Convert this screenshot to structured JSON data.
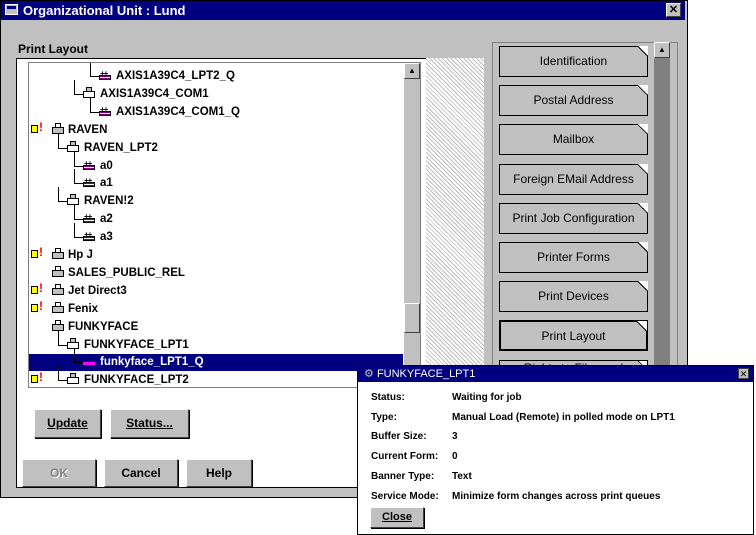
{
  "window": {
    "title": "Organizational Unit : Lund",
    "close_glyph": "✕"
  },
  "print_layout": {
    "label": "Print Layout"
  },
  "tree": [
    {
      "indent": 3,
      "icon": "queue-icon",
      "label": "AXIS1A39C4_LPT2_Q",
      "status": ""
    },
    {
      "indent": 2,
      "icon": "printer-icon",
      "label": "AXIS1A39C4_COM1",
      "status": ""
    },
    {
      "indent": 3,
      "icon": "queue-icon",
      "label": "AXIS1A39C4_COM1_Q",
      "status": ""
    },
    {
      "indent": 0,
      "icon": "print-server-icon",
      "label": "RAVEN",
      "status": "alert"
    },
    {
      "indent": 1,
      "icon": "printer-icon",
      "label": "RAVEN_LPT2",
      "status": ""
    },
    {
      "indent": 2,
      "icon": "queue-icon",
      "label": "a0",
      "status": ""
    },
    {
      "indent": 2,
      "icon": "queue-icon",
      "label": "a1",
      "status": ""
    },
    {
      "indent": 1,
      "icon": "printer-icon",
      "label": "RAVEN!2",
      "status": ""
    },
    {
      "indent": 2,
      "icon": "queue-icon",
      "label": "a2",
      "status": ""
    },
    {
      "indent": 2,
      "icon": "queue-icon",
      "label": "a3",
      "status": ""
    },
    {
      "indent": 0,
      "icon": "print-server-icon",
      "label": "Hp J",
      "status": "alert"
    },
    {
      "indent": 0,
      "icon": "print-server-icon",
      "label": "SALES_PUBLIC_REL",
      "status": ""
    },
    {
      "indent": 0,
      "icon": "print-server-icon",
      "label": "Jet Direct3",
      "status": "alert"
    },
    {
      "indent": 0,
      "icon": "print-server-icon",
      "label": "Fenix",
      "status": "alert"
    },
    {
      "indent": 0,
      "icon": "print-server-icon",
      "label": "FUNKYFACE",
      "status": ""
    },
    {
      "indent": 1,
      "icon": "printer-icon",
      "label": "FUNKYFACE_LPT1",
      "status": ""
    },
    {
      "indent": 2,
      "icon": "queue-icon",
      "label": "funkyface_LPT1_Q",
      "status": "",
      "selected": true
    },
    {
      "indent": 1,
      "icon": "printer-icon",
      "label": "FUNKYFACE_LPT2",
      "status": "printer-alert"
    }
  ],
  "buttons": {
    "update": "Update",
    "status": "Status...",
    "ok": "OK",
    "cancel": "Cancel",
    "help": "Help"
  },
  "tabs": [
    "Identification",
    "Postal Address",
    "Mailbox",
    "Foreign EMail Address",
    "Print Job Configuration",
    "Printer Forms",
    "Print Devices",
    "Print Layout",
    "Rights to Files and"
  ],
  "active_tab": "Print Layout",
  "popup": {
    "title": "FUNKYFACE_LPT1",
    "close_glyph": "✕",
    "fields": [
      {
        "key": "Status:",
        "value": "Waiting for job"
      },
      {
        "key": "Type:",
        "value": "Manual Load (Remote) in polled mode on LPT1"
      },
      {
        "key": "Buffer Size:",
        "value": "3"
      },
      {
        "key": "Current Form:",
        "value": "0"
      },
      {
        "key": "Banner Type:",
        "value": "Text"
      },
      {
        "key": "Service Mode:",
        "value": "Minimize form changes across print queues"
      }
    ],
    "close_button": "Close"
  },
  "colors": {
    "titlebar": "#000080",
    "face": "#c0c0c0",
    "selection": "#000080"
  }
}
